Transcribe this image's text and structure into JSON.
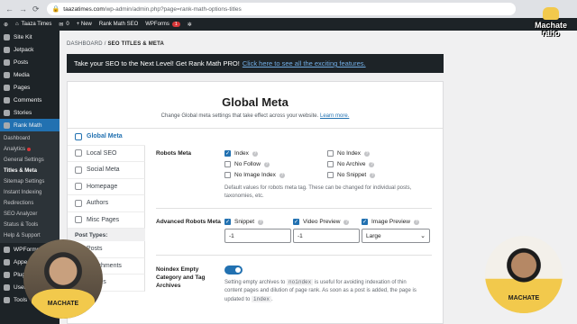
{
  "browser": {
    "url_host": "taazatimes.com",
    "url_path": "/wp-admin/admin.php?page=rank-math-options-titles"
  },
  "adminbar": {
    "site_name": "Taaza Times",
    "comments_count": "0",
    "new_label": "+ New",
    "rankmath_label": "Rank Math SEO",
    "wpforms_label": "WPForms",
    "wpforms_badge": "1"
  },
  "sidebar": {
    "items_top": [
      "Site Kit",
      "Jetpack",
      "Posts",
      "Media",
      "Pages",
      "Comments",
      "Stories"
    ],
    "active": "Rank Math",
    "submenu": [
      "Dashboard",
      "Analytics",
      "General Settings",
      "Titles & Meta",
      "Sitemap Settings",
      "Instant Indexing",
      "Redirections",
      "SEO Analyzer",
      "Status & Tools",
      "Help & Support"
    ],
    "items_bottom": [
      "WPForms",
      "Appearance",
      "Plugins",
      "Users",
      "Tools"
    ]
  },
  "breadcrumb": {
    "root": "DASHBOARD",
    "sep": "/",
    "current": "SEO TITLES & META"
  },
  "promo": {
    "text": "Take your SEO to the Next Level! Get Rank Math PRO!",
    "link": "Click here to see all the exciting features."
  },
  "panel": {
    "title": "Global Meta",
    "desc": "Change Global meta settings that take effect across your website.",
    "learn_more": "Learn more."
  },
  "tabs": [
    {
      "label": "Global Meta",
      "active": true
    },
    {
      "label": "Local SEO"
    },
    {
      "label": "Social Meta"
    },
    {
      "label": "Homepage"
    },
    {
      "label": "Authors"
    },
    {
      "label": "Misc Pages"
    }
  ],
  "tab_group": "Post Types:",
  "tabs_partial": [
    "Posts",
    "Attachments",
    "Stories"
  ],
  "robots": {
    "label": "Robots Meta",
    "options": [
      {
        "label": "Index",
        "checked": true
      },
      {
        "label": "No Index",
        "checked": false
      },
      {
        "label": "No Follow",
        "checked": false
      },
      {
        "label": "No Archive",
        "checked": false
      },
      {
        "label": "No Image Index",
        "checked": false
      },
      {
        "label": "No Snippet",
        "checked": false
      }
    ],
    "hint": "Default values for robots meta tag. These can be changed for individual posts, taxonomies, etc."
  },
  "advanced": {
    "label": "Advanced Robots Meta",
    "snippet": {
      "label": "Snippet",
      "value": "-1"
    },
    "video": {
      "label": "Video Preview",
      "value": "-1"
    },
    "image": {
      "label": "Image Preview",
      "value": "Large"
    }
  },
  "noindex": {
    "label_1": "Noindex Empty",
    "label_2": "Category and Tag",
    "label_3": "Archives",
    "hint_1": "Setting empty archives to",
    "code": "noindex",
    "hint_2": "is useful for avoiding indexation of thin",
    "hint_3": "content pages and dilution of page rank. As soon as a post is added, the page is",
    "hint_4": "updated to",
    "code2": "index",
    "enabled": true
  },
  "overlay": {
    "logo_1": "Machate",
    "logo_2": "raho",
    "shirt": "MACHATE"
  }
}
